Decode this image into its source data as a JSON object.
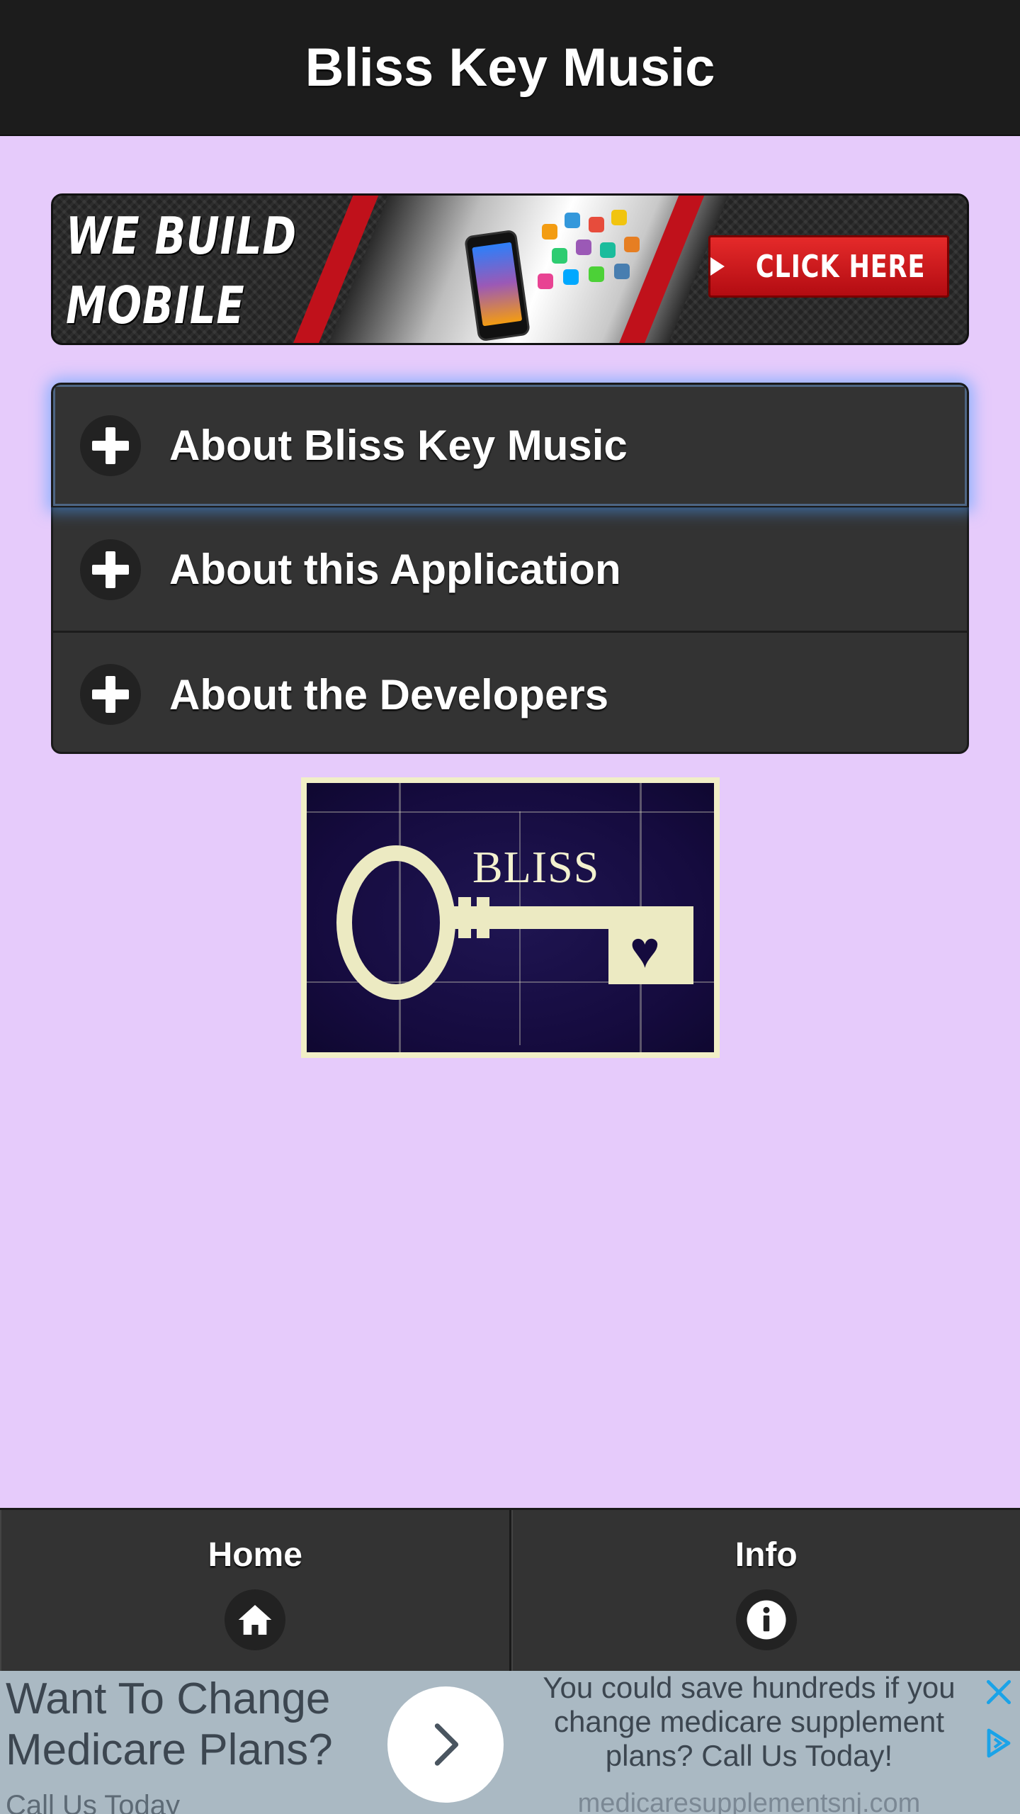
{
  "header": {
    "title": "Bliss Key Music"
  },
  "banner": {
    "headline": "WE BUILD MOBILE APPS.",
    "cta_label": "CLICK HERE"
  },
  "accordion": {
    "items": [
      {
        "label": "About Bliss Key Music",
        "icon": "plus-icon"
      },
      {
        "label": "About this Application",
        "icon": "plus-icon"
      },
      {
        "label": "About the Developers",
        "icon": "plus-icon"
      }
    ]
  },
  "logo": {
    "text": "BLISS"
  },
  "navbar": {
    "items": [
      {
        "label": "Home",
        "icon": "home-icon"
      },
      {
        "label": "Info",
        "icon": "info-icon"
      }
    ]
  },
  "ad": {
    "headline": "Want To Change Medicare Plans?",
    "subline": "Call Us Today",
    "body": "You could save hundreds if you change medicare supplement plans? Call Us Today!",
    "url": "medicaresupplementsnj.com"
  },
  "colors": {
    "background": "#e6cbfb",
    "header": "#1c1c1c",
    "bar": "#333333",
    "ad_background": "#aab9c3",
    "ad_icon": "#1aa3e8"
  }
}
